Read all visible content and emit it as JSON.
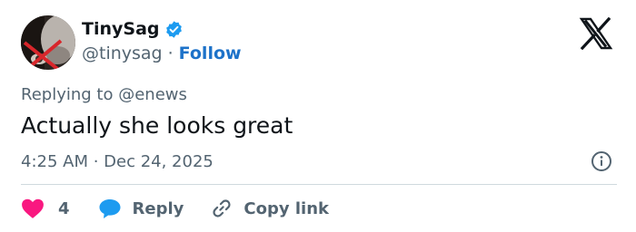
{
  "author": {
    "display_name": "TinySag",
    "handle": "@tinysag",
    "separator": "·",
    "follow_label": "Follow",
    "verified": true
  },
  "brand": {
    "logo_icon": "x-logo-icon"
  },
  "tweet": {
    "replying_prefix": "Replying to",
    "replying_to": "@enews",
    "text": "Actually she looks great",
    "timestamp": "4:25 AM · Dec 24, 2025"
  },
  "actions": {
    "like_count": "4",
    "reply_label": "Reply",
    "copy_link_label": "Copy link"
  },
  "colors": {
    "link": "#1d72c9",
    "like": "#f91880",
    "reply_icon": "#1d9bf0",
    "verified": "#1d9bf0",
    "muted": "#536471"
  }
}
